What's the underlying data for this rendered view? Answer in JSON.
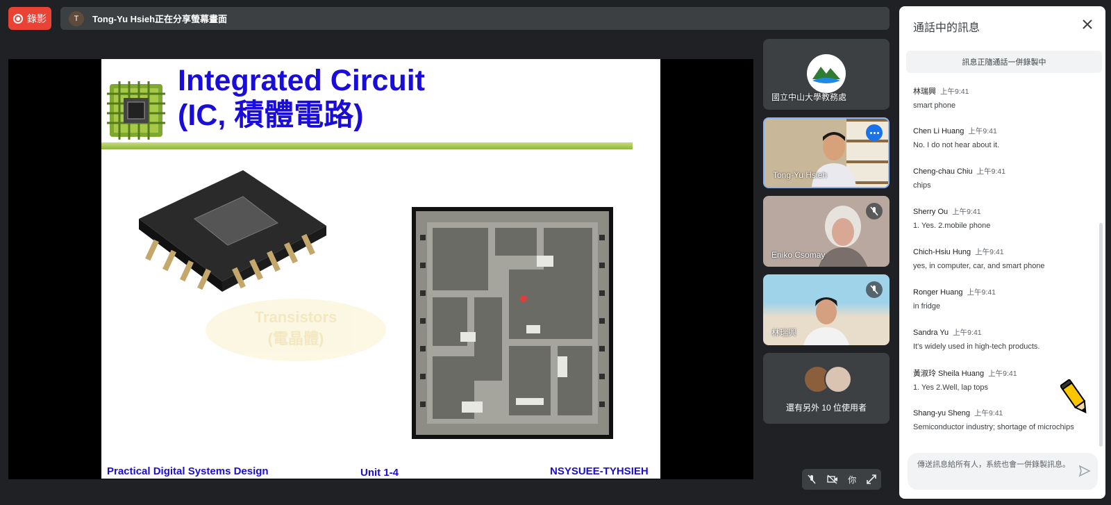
{
  "topbar": {
    "record_label": "錄影",
    "presenter_initial": "T",
    "presenting_text": "Tong-Yu Hsieh正在分享螢幕畫面"
  },
  "slide": {
    "title_line1": "Integrated Circuit",
    "title_line2": "(IC, 積體電路)",
    "cloud_text_line1": "Transistors",
    "cloud_text_line2": "(電晶體)",
    "footer_left": "Practical Digital Systems Design",
    "footer_center": "Unit 1-4",
    "footer_right": "NSYSUEE-TYHSIEH"
  },
  "participants": [
    {
      "name": "國立中山大學教務處",
      "icon": "org-logo"
    },
    {
      "name": "Tong-Yu Hsieh",
      "icon": "more-options-icon"
    },
    {
      "name": "Eniko Csomay",
      "icon": "mic-off-icon"
    },
    {
      "name": "林瑞興",
      "icon": "mic-off-icon"
    }
  ],
  "others": {
    "label": "還有另外 10 位使用者"
  },
  "self_controls": {
    "you_label": "你"
  },
  "chat": {
    "title": "通話中的訊息",
    "notice": "訊息正隨通話一併錄製中",
    "messages": [
      {
        "sender": "林瑞興",
        "time": "上午9:41",
        "text": "smart phone"
      },
      {
        "sender": "Chen Li Huang",
        "time": "上午9:41",
        "text": "No. I do not hear about it."
      },
      {
        "sender": "Cheng-chau Chiu",
        "time": "上午9:41",
        "text": "chips"
      },
      {
        "sender": "Sherry Ou",
        "time": "上午9:41",
        "text": "1. Yes. 2.mobile phone"
      },
      {
        "sender": "Chich-Hsiu Hung",
        "time": "上午9:41",
        "text": "yes, in computer, car, and smart phone"
      },
      {
        "sender": "Ronger Huang",
        "time": "上午9:41",
        "text": "in fridge"
      },
      {
        "sender": "Sandra Yu",
        "time": "上午9:41",
        "text": "It's widely used in high-tech products."
      },
      {
        "sender": "黃淑玲 Sheila Huang",
        "time": "上午9:41",
        "text": "1. Yes 2.Well, lap tops"
      },
      {
        "sender": "Shang-yu Sheng",
        "time": "上午9:41",
        "text": "Semiconductor industry; shortage of microchips"
      }
    ],
    "input_placeholder": "傳送訊息給所有人，系統也會一併錄製訊息。"
  },
  "colors": {
    "record": "#ea4335",
    "slide_title": "#1a0dd9",
    "accent": "#1a73e8"
  }
}
